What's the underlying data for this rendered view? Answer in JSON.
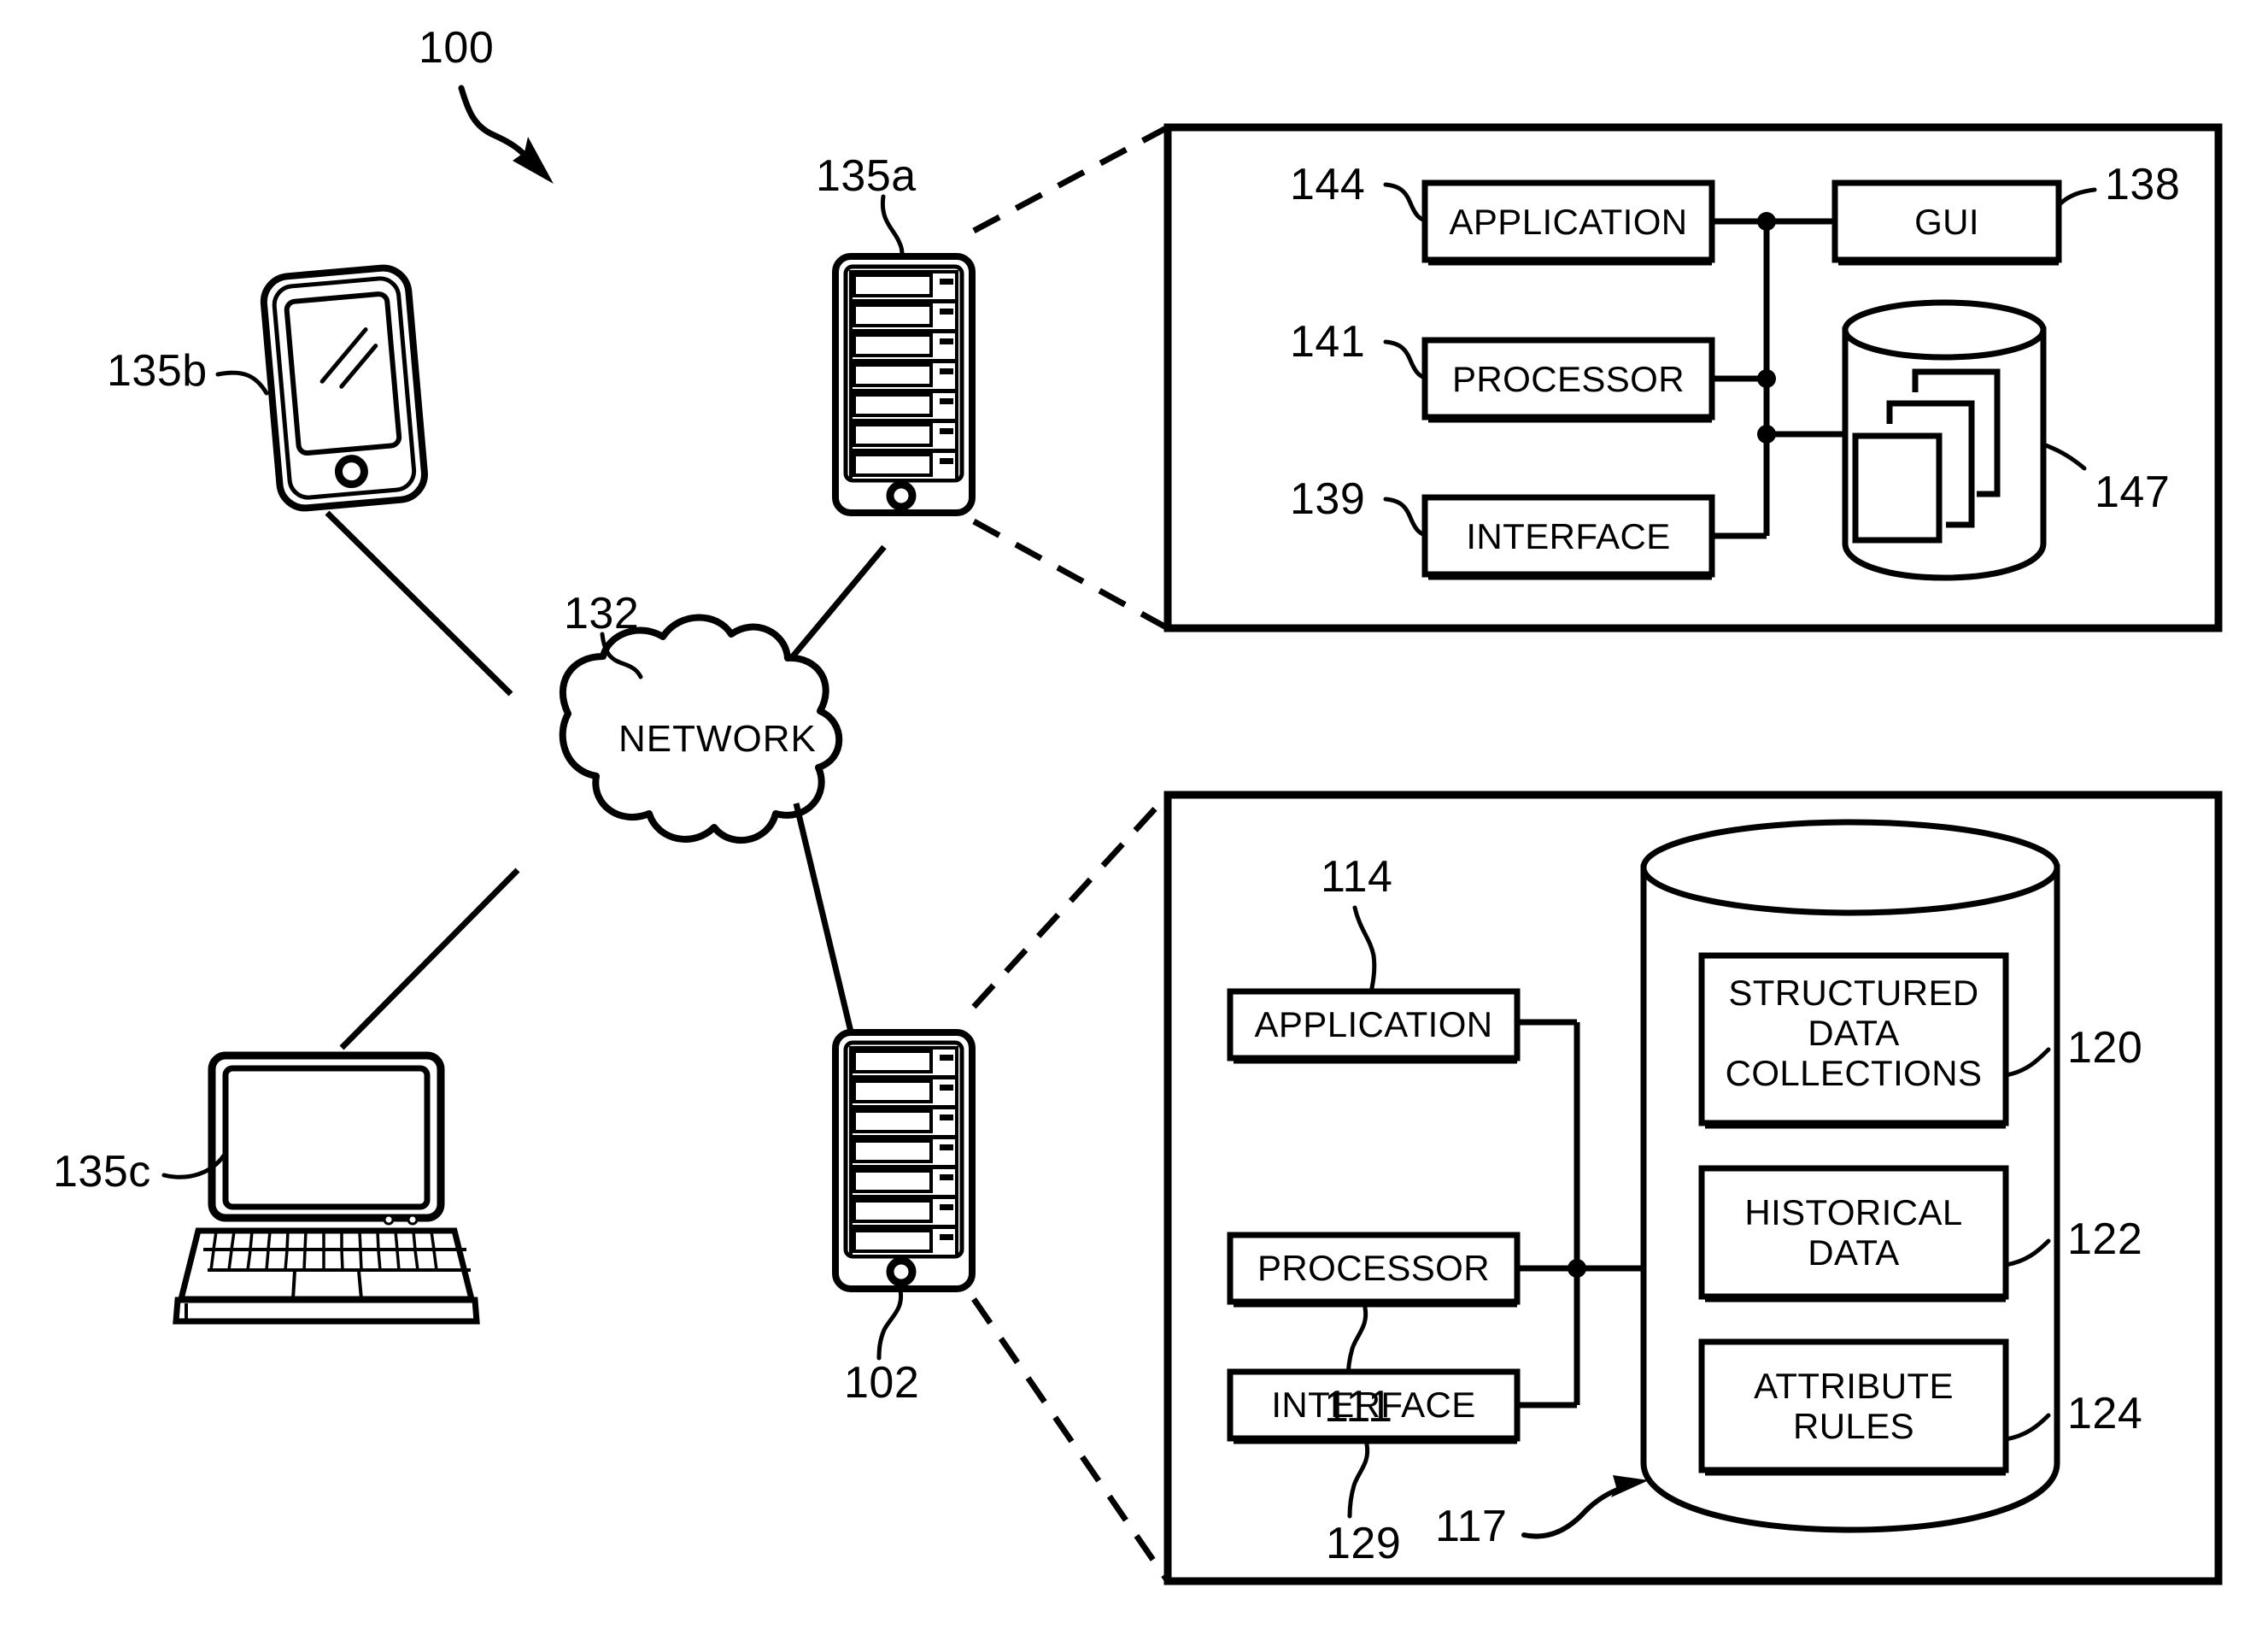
{
  "figure": {
    "reference": "100",
    "type": "patent-system-architecture-diagram"
  },
  "network": {
    "label": "NETWORK",
    "ref": "132"
  },
  "devices": [
    {
      "name": "smartphone",
      "ref": "135b"
    },
    {
      "name": "laptop",
      "ref": "135c"
    },
    {
      "name": "server-top",
      "ref": "135a"
    },
    {
      "name": "server-bottom",
      "ref": "102"
    }
  ],
  "client_detail": {
    "ref_application": "144",
    "label_application": "APPLICATION",
    "ref_processor": "141",
    "label_processor": "PROCESSOR",
    "ref_interface": "139",
    "label_interface": "INTERFACE",
    "ref_gui": "138",
    "label_gui": "GUI",
    "ref_database": "147"
  },
  "server_detail": {
    "ref_application": "114",
    "label_application": "APPLICATION",
    "ref_processor": "111",
    "label_processor": "PROCESSOR",
    "ref_interface": "129",
    "label_interface": "INTERFACE",
    "ref_database": "117",
    "store": [
      {
        "ref": "120",
        "line1": "STRUCTURED",
        "line2": "DATA",
        "line3": "COLLECTIONS"
      },
      {
        "ref": "122",
        "line1": "HISTORICAL",
        "line2": "DATA",
        "line3": ""
      },
      {
        "ref": "124",
        "line1": "ATTRIBUTE",
        "line2": "RULES",
        "line3": ""
      }
    ]
  },
  "colors": {
    "ink": "#000000",
    "paper": "#ffffff"
  }
}
